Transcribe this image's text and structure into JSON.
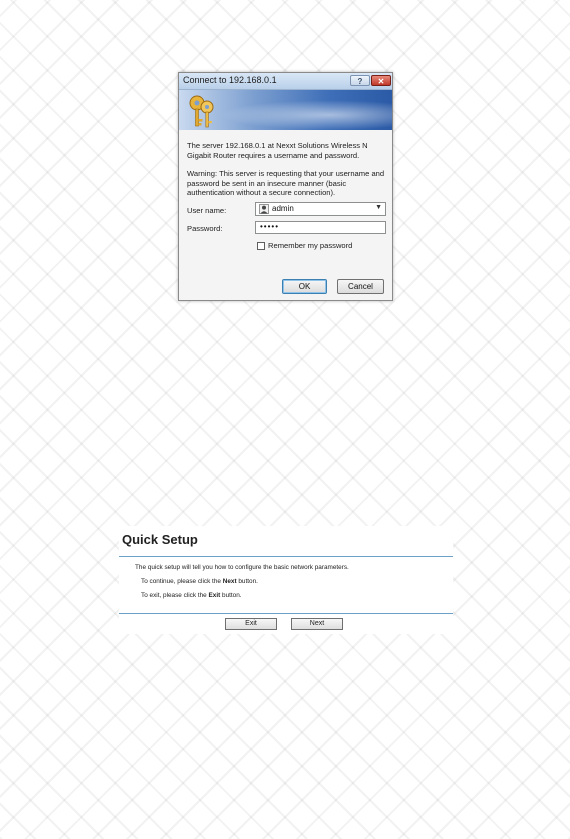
{
  "dialog": {
    "title": "Connect to 192.168.0.1",
    "help_button": "?",
    "close_button": "✕",
    "message": "The server 192.168.0.1 at Nexxt Solutions Wireless N Gigabit Router requires a username and password.",
    "warning": "Warning: This server is requesting that your username and password be sent in an insecure manner (basic authentication without a secure connection).",
    "username_label": "User name:",
    "username_value": "admin",
    "password_label": "Password:",
    "password_value": "•••••",
    "remember_label": "Remember my password",
    "ok_button": "OK",
    "cancel_button": "Cancel"
  },
  "quick_setup": {
    "title": "Quick Setup",
    "intro": "The quick setup will tell you how to configure the basic network parameters.",
    "continue_prefix": "To continue, please click the ",
    "continue_bold": "Next",
    "continue_suffix": " button.",
    "exit_prefix": "To exit, please click the ",
    "exit_bold": "Exit",
    "exit_suffix": "  button.",
    "exit_button": "Exit",
    "next_button": "Next"
  }
}
